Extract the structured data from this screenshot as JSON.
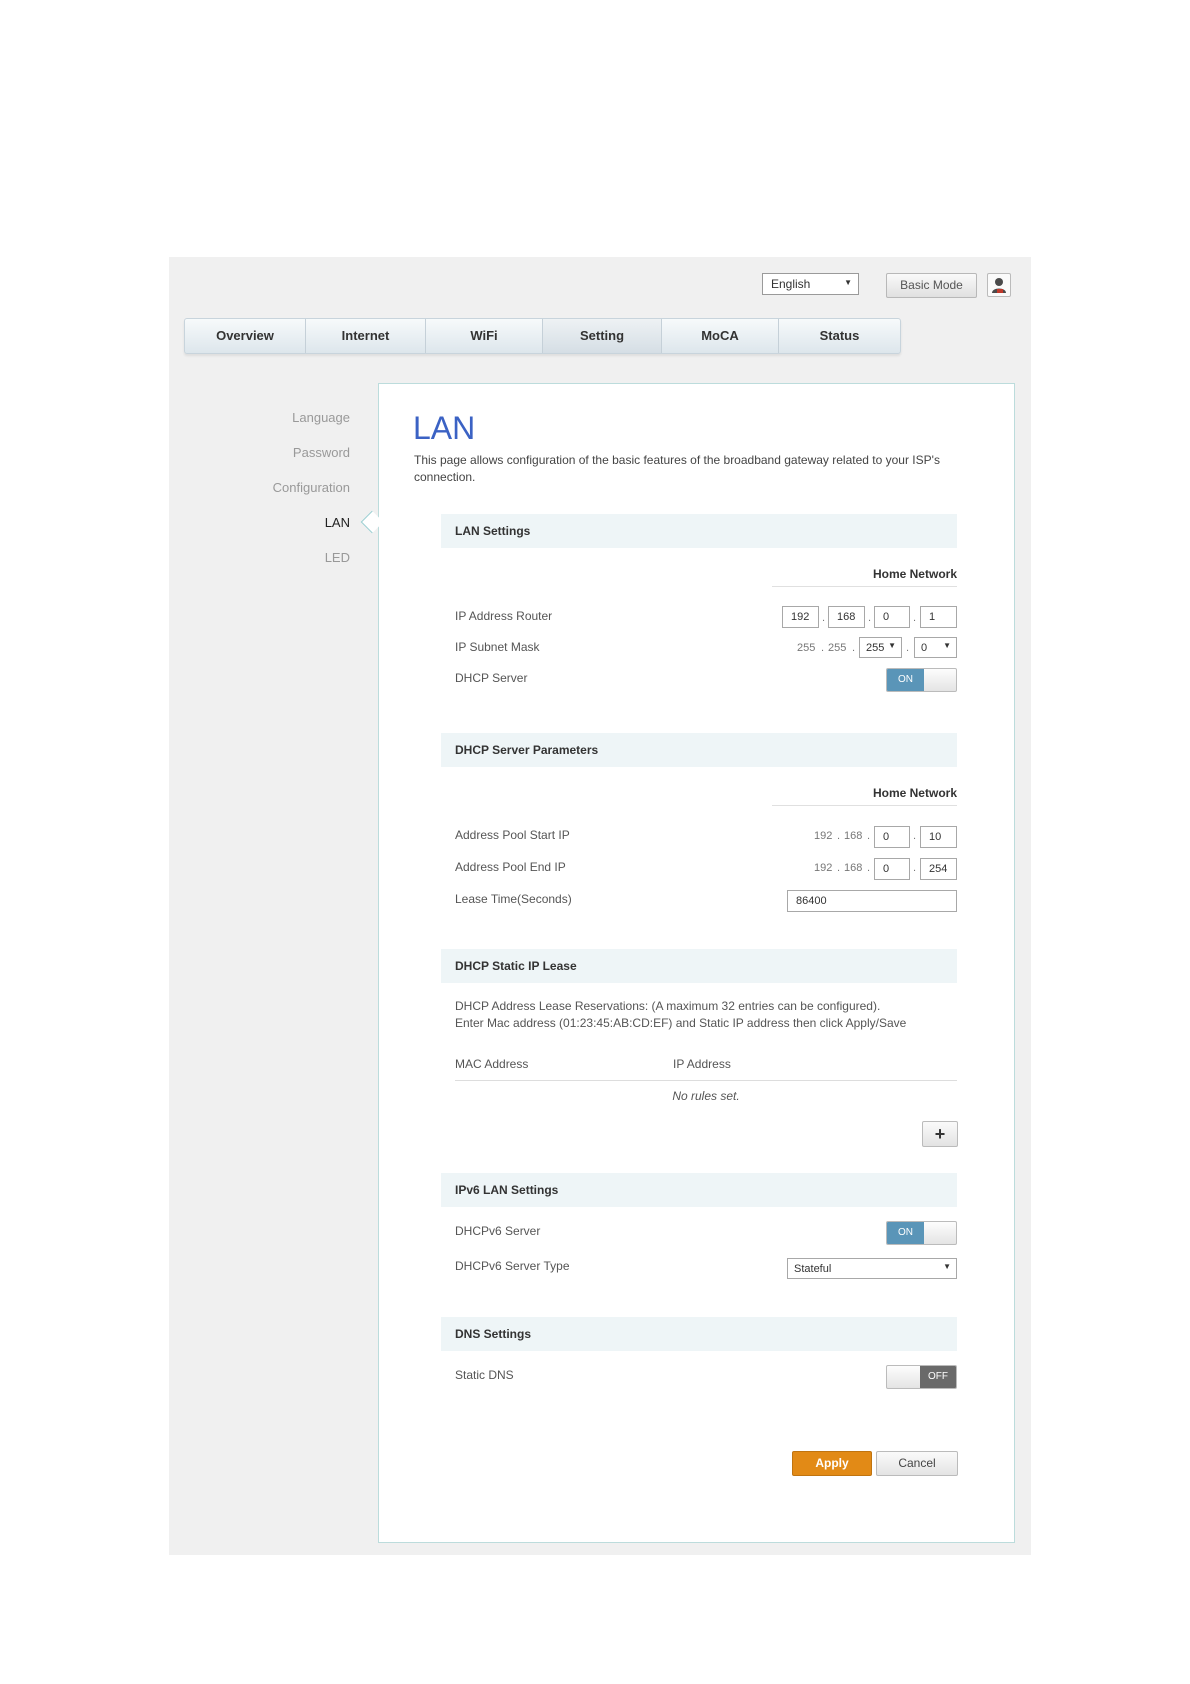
{
  "header": {
    "language": "English",
    "basic_mode_label": "Basic Mode"
  },
  "tabs": [
    "Overview",
    "Internet",
    "WiFi",
    "Setting",
    "MoCA",
    "Status"
  ],
  "active_tab": "Setting",
  "sidebar": {
    "items": [
      "Language",
      "Password",
      "Configuration",
      "LAN",
      "LED"
    ],
    "active": "LAN"
  },
  "page": {
    "title": "LAN",
    "description": "This page allows configuration of the basic features of the broadband gateway related to your ISP's connection."
  },
  "lan_settings": {
    "heading": "LAN Settings",
    "subheading": "Home Network",
    "ip_router_label": "IP Address Router",
    "ip_router": [
      "192",
      "168",
      "0",
      "1"
    ],
    "subnet_label": "IP Subnet Mask",
    "subnet_fixed_1": "255",
    "subnet_fixed_2": "255",
    "subnet_sel_3": "255",
    "subnet_sel_4": "0",
    "dhcp_label": "DHCP Server",
    "dhcp_state": "ON"
  },
  "dhcp_params": {
    "heading": "DHCP Server Parameters",
    "subheading": "Home Network",
    "pool_start_label": "Address Pool Start IP",
    "pool_start_fixed_1": "192",
    "pool_start_fixed_2": "168",
    "pool_start_3": "0",
    "pool_start_4": "10",
    "pool_end_label": "Address Pool End IP",
    "pool_end_fixed_1": "192",
    "pool_end_fixed_2": "168",
    "pool_end_3": "0",
    "pool_end_4": "254",
    "lease_label": "Lease Time(Seconds)",
    "lease_value": "86400"
  },
  "static_lease": {
    "heading": "DHCP Static IP Lease",
    "note_1": "DHCP Address Lease Reservations: (A maximum 32 entries can be configured).",
    "note_2": "Enter Mac address (01:23:45:AB:CD:EF) and Static IP address then click Apply/Save",
    "col_mac": "MAC Address",
    "col_ip": "IP Address",
    "empty": "No rules set.",
    "add_label": "+"
  },
  "ipv6": {
    "heading": "IPv6 LAN Settings",
    "dhcpv6_label": "DHCPv6 Server",
    "dhcpv6_state": "ON",
    "type_label": "DHCPv6 Server Type",
    "type_value": "Stateful"
  },
  "dns": {
    "heading": "DNS Settings",
    "static_label": "Static DNS",
    "static_state": "OFF"
  },
  "actions": {
    "apply": "Apply",
    "cancel": "Cancel"
  },
  "colors": {
    "title_blue": "#3b62c4",
    "toggle_on": "#5a95b8",
    "apply_orange": "#e28a16"
  }
}
